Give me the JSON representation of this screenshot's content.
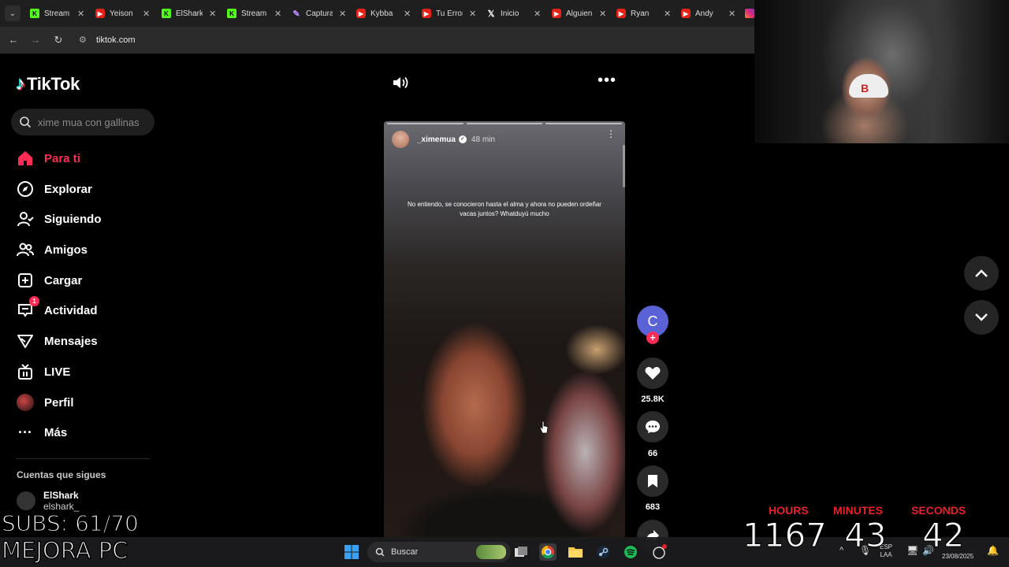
{
  "browser": {
    "tabs": [
      {
        "title": "Stream",
        "icon": "kick-icon"
      },
      {
        "title": "Yeison",
        "icon": "youtube-icon"
      },
      {
        "title": "ElShark",
        "icon": "kick-icon"
      },
      {
        "title": "Stream",
        "icon": "kick-icon"
      },
      {
        "title": "Captura",
        "icon": "feather-icon"
      },
      {
        "title": "Kybba",
        "icon": "youtube-icon"
      },
      {
        "title": "Tu Error",
        "icon": "youtube-icon"
      },
      {
        "title": "Inicio",
        "icon": "x-icon"
      },
      {
        "title": "Alguien",
        "icon": "youtube-icon"
      },
      {
        "title": "Ryan",
        "icon": "youtube-icon"
      },
      {
        "title": "Andy",
        "icon": "youtube-icon"
      }
    ],
    "url": "tiktok.com"
  },
  "tiktok": {
    "logo": "TikTok",
    "search_placeholder": "xime mua con gallinas",
    "nav": [
      {
        "label": "Para ti",
        "icon": "home-icon",
        "active": true
      },
      {
        "label": "Explorar",
        "icon": "compass-icon"
      },
      {
        "label": "Siguiendo",
        "icon": "person-follow-icon"
      },
      {
        "label": "Amigos",
        "icon": "friends-icon"
      },
      {
        "label": "Cargar",
        "icon": "upload-icon"
      },
      {
        "label": "Actividad",
        "icon": "inbox-icon",
        "badge": "1"
      },
      {
        "label": "Mensajes",
        "icon": "send-icon"
      },
      {
        "label": "LIVE",
        "icon": "live-icon"
      },
      {
        "label": "Perfil",
        "icon": "avatar"
      },
      {
        "label": "Más",
        "icon": "more-icon"
      }
    ],
    "following_title": "Cuentas que sigues",
    "following": [
      {
        "name": "ElShark",
        "handle": "elshark_"
      }
    ],
    "video": {
      "author": "_ximemua",
      "time": "48 min",
      "caption": "No entiendo, se conocieron hasta el alma y ahora no pueden ordeñar vacas juntos? Whatduyú mucho",
      "creator_initial": "C",
      "likes": "25.8K",
      "comments": "66",
      "saves": "683"
    }
  },
  "overlay": {
    "subs": "SUBS: 61/70",
    "banner": "MEJORA PC",
    "timer": {
      "hours_label": "HOURS",
      "hours": "1167",
      "minutes_label": "MINUTES",
      "minutes": "43",
      "seconds_label": "SECONDS",
      "seconds": "42"
    }
  },
  "taskbar": {
    "search": "Buscar",
    "lang": "ESP",
    "lang2": "LAA",
    "clock": "23/08/2025"
  },
  "colors": {
    "accent": "#fe2c55",
    "timer_label": "#e8202a",
    "creator": "#5b62d6"
  }
}
